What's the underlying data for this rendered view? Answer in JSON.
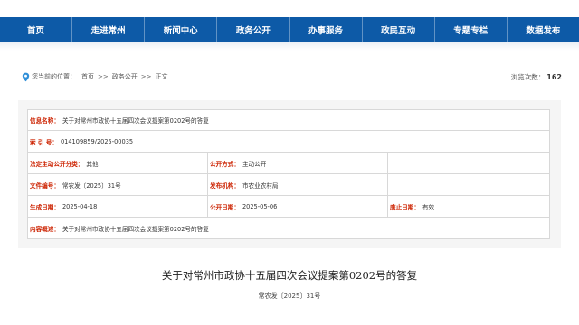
{
  "nav": {
    "items": [
      {
        "label": "首页"
      },
      {
        "label": "走进常州"
      },
      {
        "label": "新闻中心"
      },
      {
        "label": "政务公开"
      },
      {
        "label": "办事服务"
      },
      {
        "label": "政民互动"
      },
      {
        "label": "专题专栏"
      },
      {
        "label": "数据发布"
      }
    ]
  },
  "breadcrumb": {
    "label": "您当前的位置：",
    "items": [
      "首页",
      "政务公开",
      "正文"
    ],
    "separator": ">>"
  },
  "views": {
    "label": "浏览次数：",
    "count": "162"
  },
  "meta": {
    "info_name": {
      "label": "信息名称：",
      "value": "关于对常州市政协十五届四次会议提案第0202号的答复"
    },
    "index_no": {
      "label": "索  引  号：",
      "value": "014109859/2025-00035"
    },
    "category": {
      "label": "法定主动公开分类：",
      "value": "其他"
    },
    "publish_mode": {
      "label": "公开方式：",
      "value": "主动公开"
    },
    "doc_number": {
      "label": "文件编号：",
      "value": "常农发〔2025〕31号"
    },
    "publisher": {
      "label": "发布机构：",
      "value": "市农业农村局"
    },
    "created_date": {
      "label": "生成日期：",
      "value": "2025-04-18"
    },
    "publish_date": {
      "label": "公开日期：",
      "value": "2025-05-06"
    },
    "expiry_date": {
      "label": "废止日期：",
      "value": "有效"
    },
    "summary": {
      "label": "内容概述：",
      "value": "关于对常州市政协十五届四次会议提案第0202号的答复"
    }
  },
  "article": {
    "title": "关于对常州市政协十五届四次会议提案第0202号的答复",
    "doc_number": "常农发〔2025〕31号"
  },
  "colors": {
    "nav_bg": "#0d5aa7",
    "label_red": "#cc2200",
    "icon_blue": "#2f8fd8"
  }
}
